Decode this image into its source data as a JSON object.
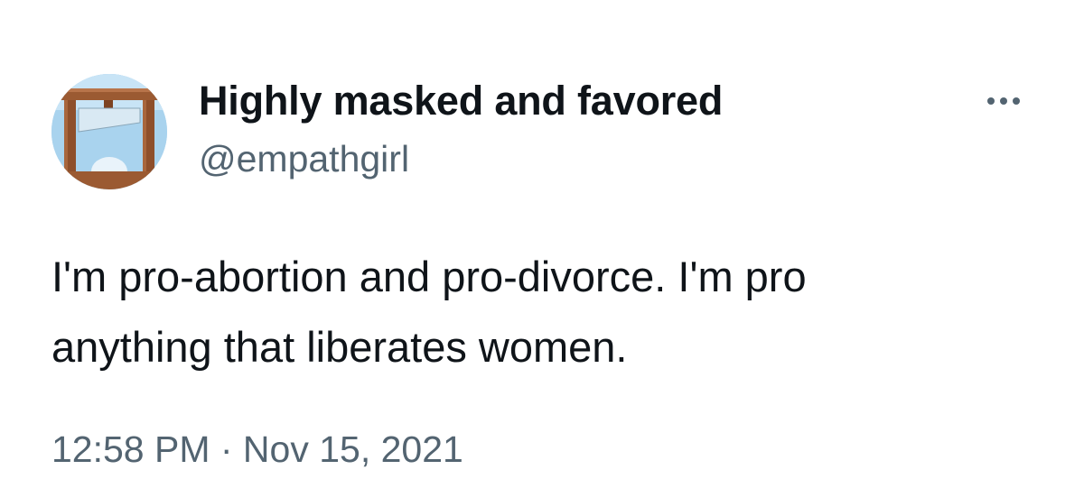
{
  "tweet": {
    "display_name": "Highly masked and favored",
    "handle": "@empathgirl",
    "text": "I'm pro-abortion and pro-divorce. I'm pro\nanything that liberates women.",
    "timestamp": "12:58 PM · Nov 15, 2021",
    "more_icon": "more-options-icon",
    "avatar_icon": "guillotine-avatar"
  },
  "colors": {
    "primary_text": "#0f1419",
    "secondary_text": "#536471",
    "background": "#ffffff",
    "avatar_sky": "#a9d3ee",
    "avatar_wood": "#9b5a32"
  }
}
